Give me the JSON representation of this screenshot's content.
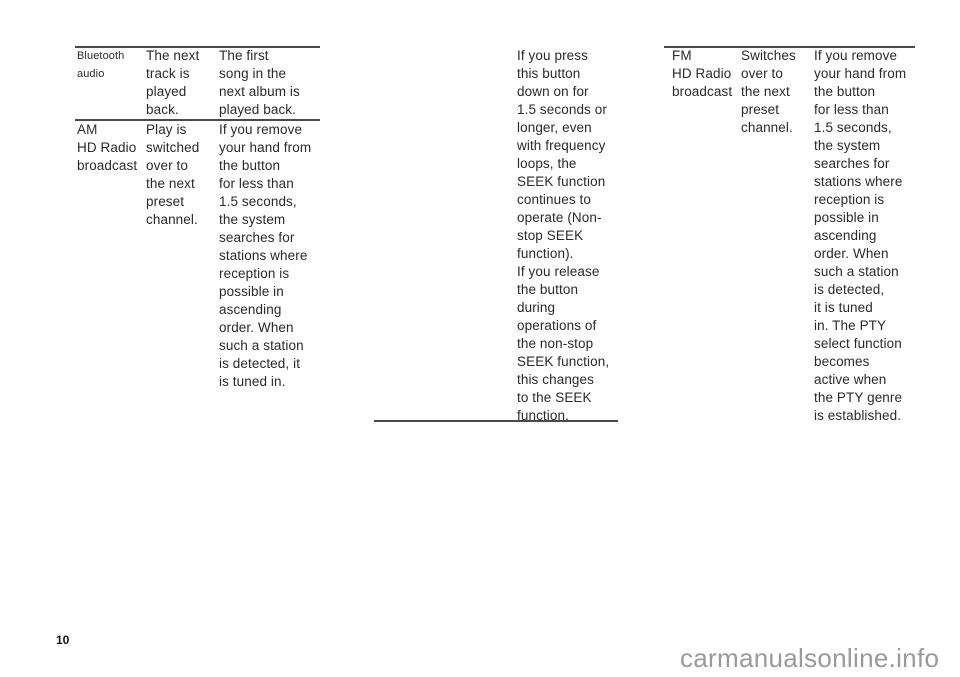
{
  "page_number": "10",
  "watermark": "carmanualsonline.info",
  "left_table": {
    "rows": [
      {
        "source": "Bluetooth\naudio",
        "short_press": "The next\ntrack is\nplayed\nback.",
        "long_press": "The first\nsong in the\nnext album is\nplayed back."
      },
      {
        "source": "AM\nHD Radio\nbroadcast",
        "short_press": "Play is\nswitched\nover to\nthe next\npreset\nchannel.",
        "long_press": "If you remove\nyour hand from\nthe button\nfor less than\n1.5 seconds,\nthe system\nsearches for\nstations where\nreception is\npossible in\nascending\norder. When\nsuch a station\nis detected, it\nis tuned in."
      }
    ]
  },
  "middle_table": {
    "rows": [
      {
        "source": "",
        "short_press": "",
        "long_press": "If you press\nthis button\ndown on for\n1.5 seconds or\nlonger, even\nwith frequency\nloops, the\nSEEK function\ncontinues to\noperate (Non-\nstop SEEK\nfunction).\nIf you release\nthe button\nduring\noperations of\nthe non-stop\nSEEK function,\nthis changes\nto the SEEK\nfunction."
      }
    ]
  },
  "right_table": {
    "rows": [
      {
        "source": "FM\nHD Radio\nbroadcast",
        "short_press": "Switches\nover to\nthe next\npreset\nchannel.",
        "long_press": "If you remove\nyour hand from\nthe button\nfor less than\n1.5 seconds,\nthe system\nsearches for\nstations where\nreception is\npossible in\nascending\norder. When\nsuch a station\nis detected,\nit is tuned\nin. The PTY\nselect function\nbecomes\nactive when\nthe PTY genre\nis established."
      }
    ]
  }
}
